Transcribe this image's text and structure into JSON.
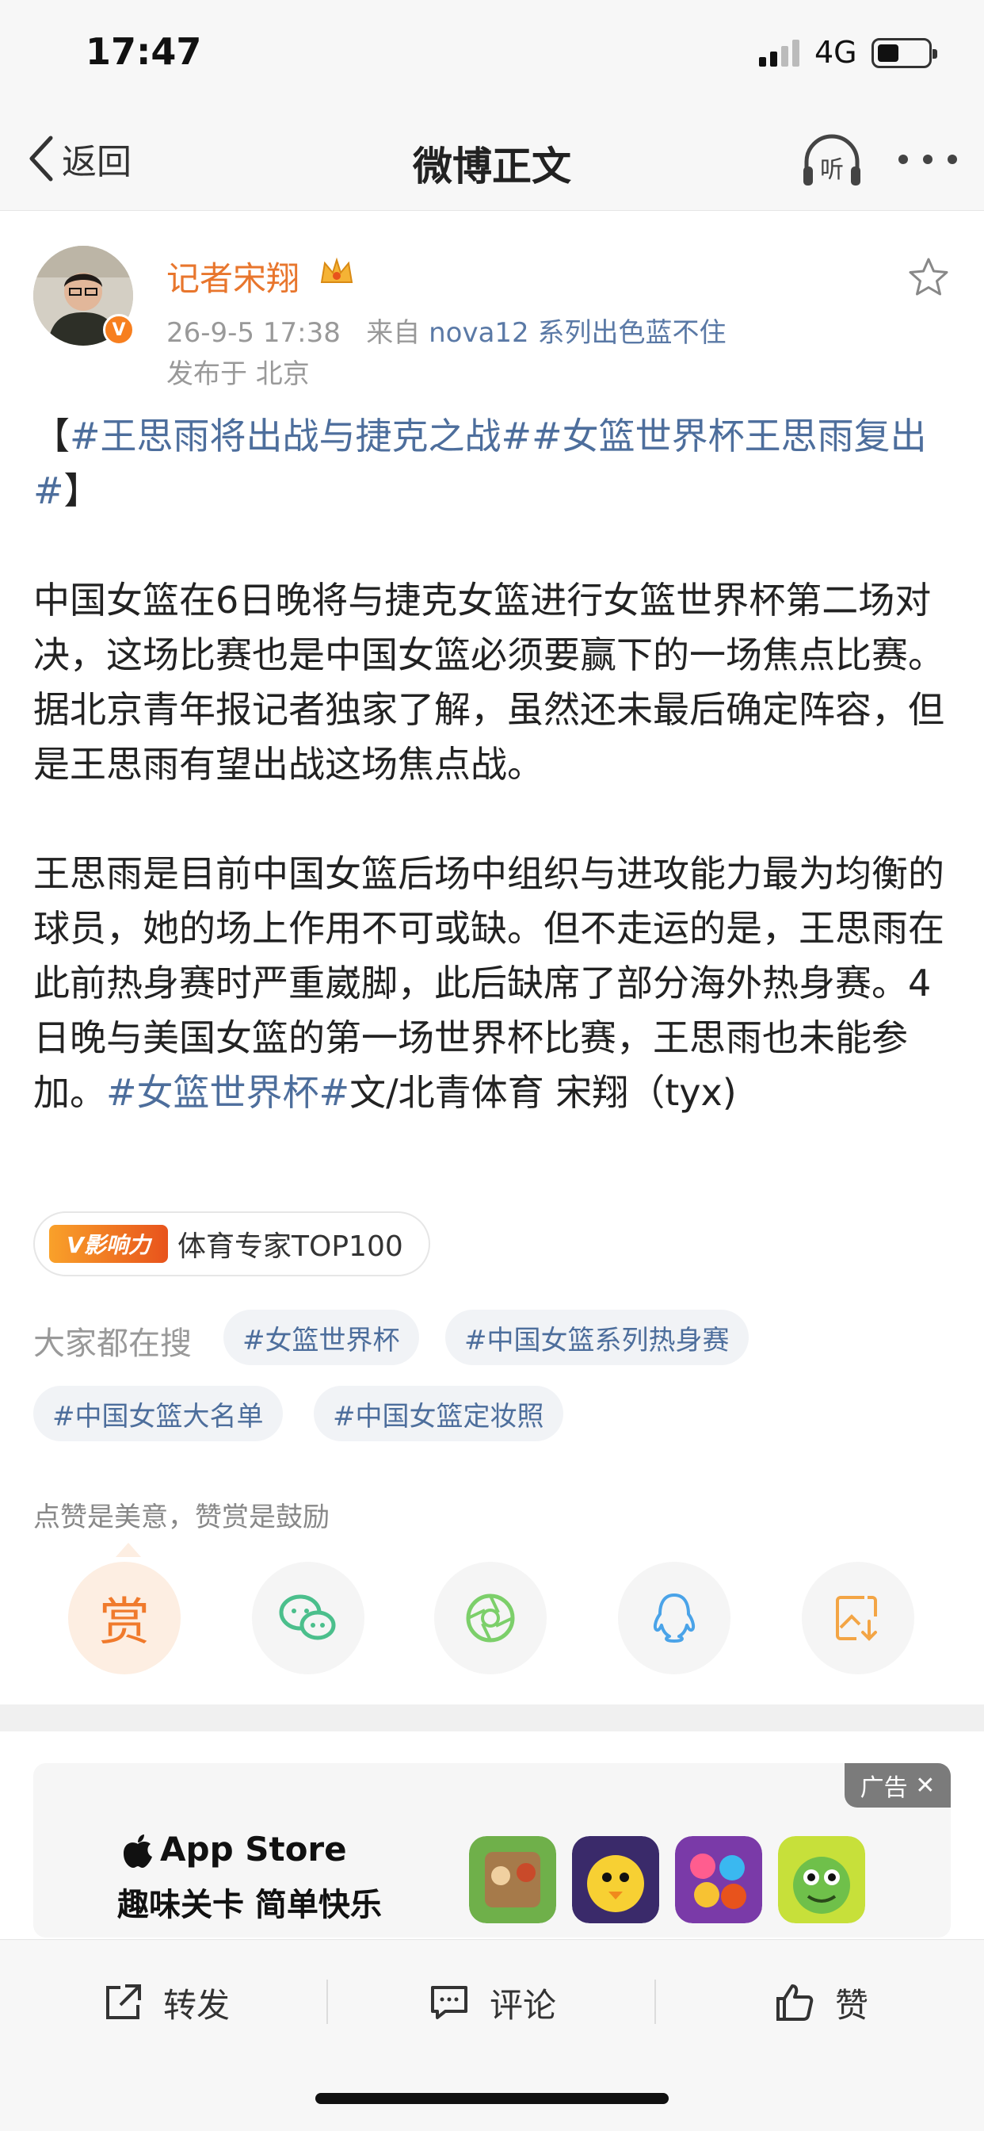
{
  "status_bar": {
    "time": "17:47",
    "network": "4G"
  },
  "nav": {
    "back_label": "返回",
    "title": "微博正文",
    "listen_icon": "headphones-listen-icon",
    "more_icon": "more-dots-icon"
  },
  "post": {
    "author": "记者宋翔",
    "timestamp": "26-9-5 17:38",
    "source_prefix": "来自",
    "source": "nova12 系列出色蓝不住",
    "location": "发布于 北京",
    "title_open": "【",
    "title_tag1": "#王思雨将出战与捷克之战#",
    "title_tag2": "#女篮世界杯王思雨复出#",
    "title_close": "】",
    "para1": "中国女篮在6日晚将与捷克女篮进行女篮世界杯第二场对决，这场比赛也是中国女篮必须要赢下的一场焦点比赛。据北京青年报记者独家了解，虽然还未最后确定阵容，但是王思雨有望出战这场焦点战。",
    "para2": "王思雨是目前中国女篮后场中组织与进攻能力最为均衡的球员，她的场上作用不可或缺。但不走运的是，王思雨在此前热身赛时严重崴脚，此后缺席了部分海外热身赛。4日晚与美国女篮的第一场世界杯比赛，王思雨也未能参加。",
    "para2_tag": "#女篮世界杯#",
    "para2_tail": "文/北青体育 宋翔（tyx)"
  },
  "influence": {
    "logo_text": "V影响力",
    "label": "体育专家TOP100"
  },
  "search": {
    "label": "大家都在搜",
    "chips": [
      "#女篮世界杯",
      "#中国女篮系列热身赛",
      "#中国女篮大名单",
      "#中国女篮定妆照"
    ]
  },
  "reward": {
    "hint": "点赞是美意，赞赏是鼓励",
    "reward_label": "赏",
    "buttons": [
      "wechat-icon",
      "moments-icon",
      "qq-icon",
      "save-image-icon"
    ]
  },
  "ad": {
    "tag": "广告",
    "store_name": "App Store",
    "slogan": "趣味关卡 简单快乐"
  },
  "actions": {
    "forward": "转发",
    "comment": "评论",
    "like": "赞"
  },
  "colors": {
    "accent_orange": "#e8762d",
    "link_blue": "#4d6e9c",
    "meta_gray": "#999999"
  }
}
